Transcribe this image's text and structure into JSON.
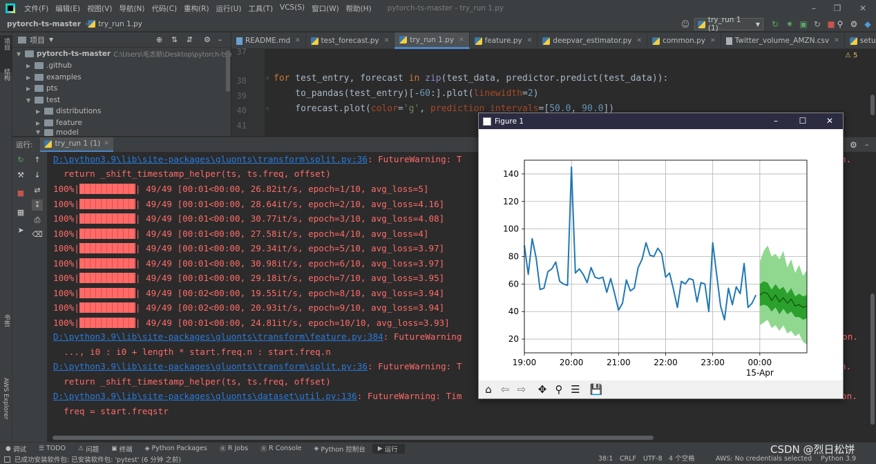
{
  "menubar": {
    "items": [
      "文件(F)",
      "编辑(E)",
      "视图(V)",
      "导航(N)",
      "代码(C)",
      "重构(R)",
      "运行(U)",
      "工具(T)",
      "VCS(S)",
      "窗口(W)",
      "帮助(H)"
    ],
    "window_title": "pytorch-ts-master - try_run 1.py"
  },
  "navbar": {
    "project": "pytorch-ts-master",
    "file": "try_run 1.py",
    "run_config": "try_run 1 (1)"
  },
  "project_panel": {
    "title": "项目",
    "root": "pytorch-ts-master",
    "root_path": "C:\\Users\\毛志航\\Desktop\\pytorch-ts-m",
    "items": [
      ".github",
      "examples",
      "pts",
      "test",
      "distributions",
      "feature",
      "model"
    ]
  },
  "left_tools": {
    "project": "项目",
    "structure": "结构",
    "bookmarks": "书签",
    "aws": "AWS Explorer"
  },
  "tabs": [
    "README.md",
    "test_forecast.py",
    "try_run 1.py",
    "feature.py",
    "deepvar_estimator.py",
    "common.py",
    "Twitter_volume_AMZN.csv",
    "setup.py"
  ],
  "inspection_count": "5",
  "code": {
    "lines": [
      {
        "num": "37",
        "text": ""
      },
      {
        "num": "38",
        "text": ""
      },
      {
        "num": "39",
        "text": "for test_entry, forecast in zip(test_data, predictor.predict(test_data)):"
      },
      {
        "num": "40",
        "text": "    to_pandas(test_entry)[-60:].plot(linewidth=2)"
      },
      {
        "num": "41",
        "text": "    forecast.plot(color='g', prediction_intervals=[50.0, 90.0])"
      }
    ]
  },
  "run_panel": {
    "label": "运行:",
    "tab": "try_run 1 (1)"
  },
  "console": {
    "warn1_path": "D:\\python3.9\\lib\\site-packages\\gluonts\\transform\\split.py:36",
    "warn1_msg": ": FutureWarning: T",
    "warn1_tail": "n.",
    "warn1_code": "  return _shift_timestamp_helper(ts, ts.freq, offset)",
    "progress": [
      {
        "pct": "100%|",
        "text": "| 49/49 [00:01<00:00, 26.82it/s, epoch=1/10, avg_loss=5]"
      },
      {
        "pct": "100%|",
        "text": "| 49/49 [00:01<00:00, 28.64it/s, epoch=2/10, avg_loss=4.16]"
      },
      {
        "pct": "100%|",
        "text": "| 49/49 [00:01<00:00, 30.77it/s, epoch=3/10, avg_loss=4.08]"
      },
      {
        "pct": "100%|",
        "text": "| 49/49 [00:01<00:00, 27.58it/s, epoch=4/10, avg_loss=4]"
      },
      {
        "pct": "100%|",
        "text": "| 49/49 [00:01<00:00, 29.34it/s, epoch=5/10, avg_loss=3.97]"
      },
      {
        "pct": "100%|",
        "text": "| 49/49 [00:01<00:00, 30.98it/s, epoch=6/10, avg_loss=3.97]"
      },
      {
        "pct": "100%|",
        "text": "| 49/49 [00:01<00:00, 29.18it/s, epoch=7/10, avg_loss=3.95]"
      },
      {
        "pct": "100%|",
        "text": "| 49/49 [00:02<00:00, 19.55it/s, epoch=8/10, avg_loss=3.94]"
      },
      {
        "pct": "100%|",
        "text": "| 49/49 [00:02<00:00, 20.93it/s, epoch=9/10, avg_loss=3.94]"
      },
      {
        "pct": "100%|",
        "text": "| 49/49 [00:01<00:00, 24.81it/s, epoch=10/10, avg_loss=3.93]"
      }
    ],
    "warn2_path": "D:\\python3.9\\lib\\site-packages\\gluonts\\transform\\feature.py:384",
    "warn2_msg": ": FutureWarning",
    "warn2_tail": "sion.",
    "warn2_code": "  ..., i0 : i0 + length * start.freq.n : start.freq.n",
    "warn3_path": "D:\\python3.9\\lib\\site-packages\\gluonts\\transform\\split.py:36",
    "warn3_msg": ": FutureWarning: T",
    "warn3_tail": "n.",
    "warn3_code": "  return _shift_timestamp_helper(ts, ts.freq, offset)",
    "warn4_path": "D:\\python3.9\\lib\\site-packages\\gluonts\\dataset\\util.py:136",
    "warn4_msg": ": FutureWarning: Tim",
    "warn4_tail": "on.",
    "warn4_code": "  freq = start.freqstr"
  },
  "bottom_tools": [
    "调试",
    "TODO",
    "问题",
    "终端",
    "Python Packages",
    "R Jobs",
    "R Console",
    "Python 控制台",
    "运行"
  ],
  "status": {
    "message": "已成功安装软件包: 已安装软件包: 'pytest' (6 分钟 之前)",
    "position": "38:1",
    "line_sep": "CRLF",
    "encoding": "UTF-8",
    "indent": "4 个空格",
    "aws": "AWS: No credentials selected",
    "interpreter": "Python 3.9"
  },
  "watermark": "CSDN @烈日松饼",
  "figure": {
    "title": "Figure 1",
    "toolbar": [
      "home-icon",
      "back-icon",
      "forward-icon",
      "pan-icon",
      "zoom-icon",
      "configure-icon",
      "save-icon"
    ]
  },
  "chart_data": {
    "type": "line",
    "title": "",
    "xlabel": "",
    "ylabel": "",
    "x_ticks": [
      "19:00",
      "20:00",
      "21:00",
      "22:00",
      "23:00",
      "00:00"
    ],
    "x_tick_sublabel": "15-Apr",
    "y_ticks": [
      20,
      40,
      60,
      80,
      100,
      120,
      140
    ],
    "ylim": [
      10,
      150
    ],
    "grid": true,
    "series": [
      {
        "color": "#1f77b4",
        "x_unit": "minutes after 19:00",
        "x": [
          0,
          5,
          10,
          15,
          20,
          25,
          30,
          35,
          40,
          45,
          50,
          55,
          60,
          65,
          70,
          75,
          80,
          85,
          90,
          95,
          100,
          105,
          110,
          115,
          120,
          125,
          130,
          135,
          140,
          145,
          150,
          155,
          160,
          165,
          170,
          175,
          180,
          185,
          190,
          195,
          200,
          205,
          210,
          215,
          220,
          225,
          230,
          235,
          240,
          245,
          250,
          255,
          260,
          265,
          270,
          275,
          280,
          285,
          290,
          295
        ],
        "values": [
          88,
          67,
          93,
          79,
          56,
          57,
          69,
          71,
          76,
          62,
          60,
          59,
          145,
          68,
          71,
          67,
          61,
          72,
          65,
          64,
          65,
          54,
          64,
          53,
          41,
          46,
          63,
          55,
          57,
          72,
          78,
          90,
          81,
          80,
          86,
          82,
          65,
          68,
          56,
          43,
          62,
          60,
          64,
          63,
          47,
          61,
          60,
          40,
          90,
          67,
          44,
          34,
          57,
          45,
          58,
          53,
          75,
          43,
          46,
          52
        ]
      }
    ],
    "forecast": {
      "color": "green",
      "x_unit": "minutes after 19:00",
      "x": [
        300,
        305,
        310,
        315,
        320,
        325,
        330,
        335,
        340,
        345,
        350,
        355,
        360
      ],
      "median": [
        52,
        54,
        53,
        48,
        52,
        47,
        50,
        46,
        49,
        44,
        45,
        43,
        44
      ],
      "interval_50": {
        "lower": [
          44,
          45,
          44,
          40,
          43,
          38,
          42,
          38,
          40,
          36,
          36,
          34,
          35
        ],
        "upper": [
          60,
          62,
          61,
          56,
          60,
          56,
          58,
          53,
          57,
          51,
          53,
          51,
          52
        ]
      },
      "interval_90": {
        "lower": [
          30,
          32,
          34,
          28,
          30,
          26,
          30,
          24,
          26,
          22,
          24,
          18,
          16
        ],
        "upper": [
          76,
          84,
          88,
          80,
          82,
          78,
          84,
          72,
          78,
          68,
          74,
          66,
          70
        ]
      }
    }
  }
}
